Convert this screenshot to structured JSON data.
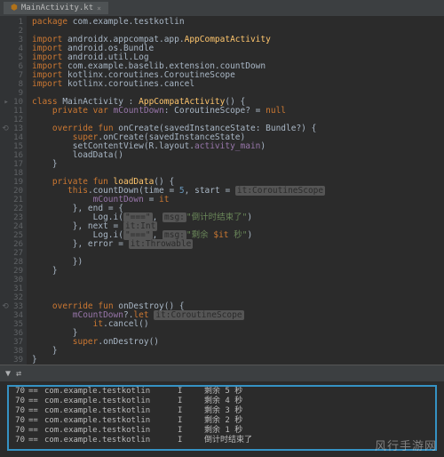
{
  "tab": {
    "filename": "MainActivity.kt"
  },
  "code": {
    "lines": [
      {
        "n": 1,
        "segs": [
          [
            "kw",
            "package "
          ],
          [
            "pkg",
            "com.example.testkotlin"
          ]
        ]
      },
      {
        "n": 2,
        "segs": []
      },
      {
        "n": 3,
        "segs": [
          [
            "kw",
            "import "
          ],
          [
            "pkg",
            "androidx.appcompat.app."
          ],
          [
            "type",
            "AppCompatActivity"
          ]
        ]
      },
      {
        "n": 4,
        "segs": [
          [
            "kw",
            "import "
          ],
          [
            "pkg",
            "android.os.Bundle"
          ]
        ]
      },
      {
        "n": 5,
        "segs": [
          [
            "kw",
            "import "
          ],
          [
            "pkg",
            "android.util.Log"
          ]
        ]
      },
      {
        "n": 6,
        "segs": [
          [
            "kw",
            "import "
          ],
          [
            "pkg",
            "com.example.baselib.extension.countDown"
          ]
        ]
      },
      {
        "n": 7,
        "segs": [
          [
            "kw",
            "import "
          ],
          [
            "pkg",
            "kotlinx.coroutines.CoroutineScope"
          ]
        ]
      },
      {
        "n": 8,
        "segs": [
          [
            "kw",
            "import "
          ],
          [
            "pkg",
            "kotlinx.coroutines.cancel"
          ]
        ]
      },
      {
        "n": 9,
        "segs": []
      },
      {
        "n": 10,
        "icon": "▸",
        "segs": [
          [
            "kw",
            "class "
          ],
          [
            "cls",
            "MainActivity : "
          ],
          [
            "type",
            "AppCompatActivity"
          ],
          [
            "brace",
            "() {"
          ]
        ]
      },
      {
        "n": 11,
        "segs": [
          [
            "",
            "    "
          ],
          [
            "kw",
            "private var "
          ],
          [
            "prop",
            "mCountDown"
          ],
          [
            "",
            ": CoroutineScope? = "
          ],
          [
            "kw",
            "null"
          ]
        ]
      },
      {
        "n": 12,
        "segs": []
      },
      {
        "n": 13,
        "icon": "⟲",
        "segs": [
          [
            "",
            "    "
          ],
          [
            "override",
            "override "
          ],
          [
            "kw-fun",
            "fun "
          ],
          [
            "",
            "onCreate(savedInstanceState: Bundle?) {"
          ]
        ]
      },
      {
        "n": 14,
        "segs": [
          [
            "",
            "        "
          ],
          [
            "kw",
            "super"
          ],
          [
            "",
            ".onCreate(savedInstanceState)"
          ]
        ]
      },
      {
        "n": 15,
        "segs": [
          [
            "",
            "        setContentView(R.layout."
          ],
          [
            "prop",
            "activity_main"
          ],
          [
            "",
            ")"
          ]
        ]
      },
      {
        "n": 16,
        "segs": [
          [
            "",
            "        loadData()"
          ]
        ]
      },
      {
        "n": 17,
        "segs": [
          [
            "",
            "    }"
          ]
        ]
      },
      {
        "n": 18,
        "segs": []
      },
      {
        "n": 19,
        "segs": [
          [
            "",
            "    "
          ],
          [
            "kw",
            "private fun "
          ],
          [
            "type",
            "loadData"
          ],
          [
            "",
            "() {"
          ]
        ]
      },
      {
        "n": 20,
        "segs": [
          [
            "",
            "       "
          ],
          [
            "kw",
            "this"
          ],
          [
            "",
            ".countDown("
          ],
          [
            "param",
            "time"
          ],
          [
            "",
            " = "
          ],
          [
            "num",
            "5"
          ],
          [
            "",
            ", "
          ],
          [
            "param",
            "start"
          ],
          [
            "",
            " = "
          ],
          [
            "hl-bg",
            "it:CoroutineScope"
          ]
        ]
      },
      {
        "n": 21,
        "segs": [
          [
            "",
            "            "
          ],
          [
            "prop",
            "mCountDown"
          ],
          [
            "",
            " = "
          ],
          [
            "kw",
            "it"
          ]
        ]
      },
      {
        "n": 22,
        "segs": [
          [
            "",
            "        }, "
          ],
          [
            "param",
            "end"
          ],
          [
            "",
            " = {"
          ]
        ]
      },
      {
        "n": 23,
        "segs": [
          [
            "",
            "            Log.i("
          ],
          [
            "hl-bg",
            "\"===\""
          ],
          [
            "",
            ", "
          ],
          [
            "hl-bg",
            "msg:"
          ],
          [
            "str",
            "\"倒计时结束了\""
          ],
          [
            "",
            ")"
          ]
        ]
      },
      {
        "n": 24,
        "segs": [
          [
            "",
            "        }, "
          ],
          [
            "param",
            "next"
          ],
          [
            "",
            " = "
          ],
          [
            "hl-bg",
            "it:Int"
          ]
        ]
      },
      {
        "n": 25,
        "segs": [
          [
            "",
            "            Log.i("
          ],
          [
            "hl-bg",
            "\"===\""
          ],
          [
            "",
            ", "
          ],
          [
            "hl-bg",
            "msg:"
          ],
          [
            "str",
            "\"剩余 "
          ],
          [
            "kw",
            "$it"
          ],
          [
            "str",
            " 秒\""
          ],
          [
            "",
            ")"
          ]
        ]
      },
      {
        "n": 26,
        "segs": [
          [
            "",
            "        }, "
          ],
          [
            "param",
            "error"
          ],
          [
            "",
            " = "
          ],
          [
            "hl-bg",
            "it:Throwable"
          ]
        ]
      },
      {
        "n": 27,
        "segs": []
      },
      {
        "n": 28,
        "segs": [
          [
            "",
            "        })"
          ]
        ]
      },
      {
        "n": 29,
        "segs": [
          [
            "",
            "    }"
          ]
        ]
      },
      {
        "n": 30,
        "segs": []
      },
      {
        "n": 31,
        "segs": []
      },
      {
        "n": 32,
        "segs": []
      },
      {
        "n": 33,
        "icon": "⟲",
        "segs": [
          [
            "",
            "    "
          ],
          [
            "override",
            "override "
          ],
          [
            "kw-fun",
            "fun "
          ],
          [
            "",
            "onDestroy() {"
          ]
        ]
      },
      {
        "n": 34,
        "segs": [
          [
            "",
            "        "
          ],
          [
            "prop",
            "mCountDown"
          ],
          [
            "",
            "?."
          ],
          [
            "kw",
            "let"
          ],
          [
            "",
            " "
          ],
          [
            "hl-bg",
            "it:CoroutineScope"
          ]
        ]
      },
      {
        "n": 35,
        "segs": [
          [
            "",
            "            "
          ],
          [
            "kw",
            "it"
          ],
          [
            "",
            ".cancel()"
          ]
        ]
      },
      {
        "n": 36,
        "segs": [
          [
            "",
            "        }"
          ]
        ]
      },
      {
        "n": 37,
        "segs": [
          [
            "",
            "        "
          ],
          [
            "kw",
            "super"
          ],
          [
            "",
            ".onDestroy()"
          ]
        ]
      },
      {
        "n": 38,
        "segs": [
          [
            "",
            "    }"
          ]
        ]
      },
      {
        "n": 39,
        "segs": [
          [
            "",
            "}"
          ]
        ]
      }
    ]
  },
  "log": {
    "rows": [
      {
        "pid": "70",
        "tag": "==",
        "pkg": "com.example.testkotlin",
        "level": "I",
        "msg": "剩余 5 秒"
      },
      {
        "pid": "70",
        "tag": "==",
        "pkg": "com.example.testkotlin",
        "level": "I",
        "msg": "剩余 4 秒"
      },
      {
        "pid": "70",
        "tag": "==",
        "pkg": "com.example.testkotlin",
        "level": "I",
        "msg": "剩余 3 秒"
      },
      {
        "pid": "70",
        "tag": "==",
        "pkg": "com.example.testkotlin",
        "level": "I",
        "msg": "剩余 2 秒"
      },
      {
        "pid": "70",
        "tag": "==",
        "pkg": "com.example.testkotlin",
        "level": "I",
        "msg": "剩余 1 秒"
      },
      {
        "pid": "70",
        "tag": "==",
        "pkg": "com.example.testkotlin",
        "level": "I",
        "msg": "倒计时结束了"
      }
    ]
  },
  "watermark": "风行手游网"
}
